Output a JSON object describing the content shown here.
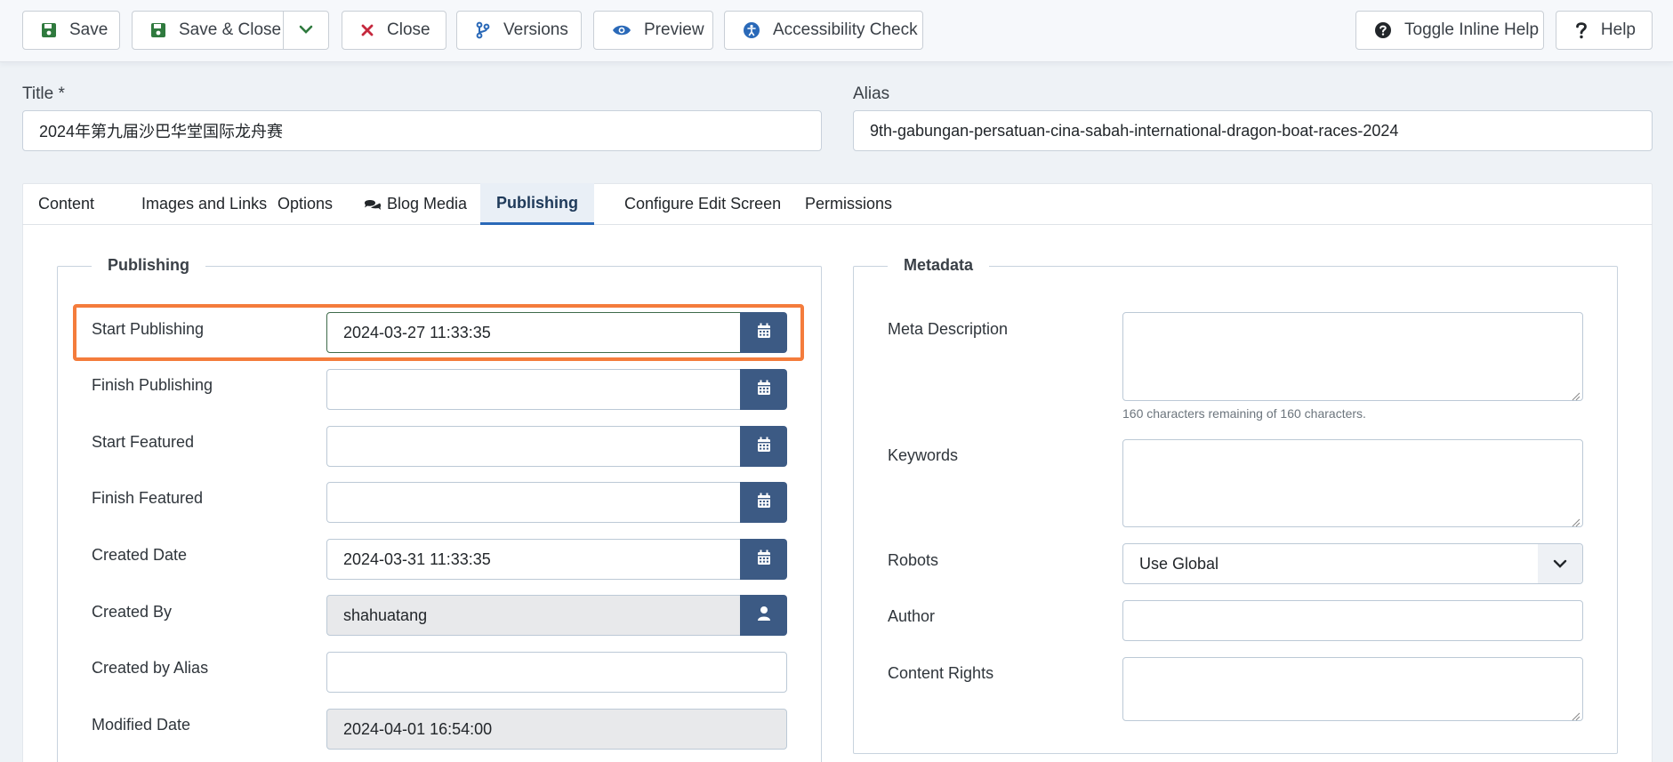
{
  "toolbar": {
    "save": "Save",
    "save_close": "Save & Close",
    "close": "Close",
    "versions": "Versions",
    "preview": "Preview",
    "accessibility": "Accessibility Check",
    "toggle_help": "Toggle Inline Help",
    "help": "Help"
  },
  "title_field": {
    "label": "Title *",
    "value": "2024年第九届沙巴华堂国际龙舟赛"
  },
  "alias_field": {
    "label": "Alias",
    "value": "9th-gabungan-persatuan-cina-sabah-international-dragon-boat-races-2024"
  },
  "tabs": [
    {
      "label": "Content"
    },
    {
      "label": "Images and Links"
    },
    {
      "label": "Options"
    },
    {
      "label": "Blog Media"
    },
    {
      "label": "Publishing"
    },
    {
      "label": "Configure Edit Screen"
    },
    {
      "label": "Permissions"
    }
  ],
  "active_tab": "Publishing",
  "publishing": {
    "legend": "Publishing",
    "start_publishing": {
      "label": "Start Publishing",
      "value": "2024-03-27 11:33:35"
    },
    "finish_publishing": {
      "label": "Finish Publishing",
      "value": ""
    },
    "start_featured": {
      "label": "Start Featured",
      "value": ""
    },
    "finish_featured": {
      "label": "Finish Featured",
      "value": ""
    },
    "created_date": {
      "label": "Created Date",
      "value": "2024-03-31 11:33:35"
    },
    "created_by": {
      "label": "Created By",
      "value": "shahuatang"
    },
    "created_by_alias": {
      "label": "Created by Alias",
      "value": ""
    },
    "modified_date": {
      "label": "Modified Date",
      "value": "2024-04-01 16:54:00"
    }
  },
  "metadata": {
    "legend": "Metadata",
    "meta_description": {
      "label": "Meta Description",
      "hint": "160 characters remaining of 160 characters."
    },
    "keywords": {
      "label": "Keywords"
    },
    "robots": {
      "label": "Robots",
      "value": "Use Global"
    },
    "author": {
      "label": "Author",
      "value": ""
    },
    "content_rights": {
      "label": "Content Rights"
    }
  },
  "colors": {
    "accent": "#3c5a84",
    "highlight": "#f47c3c",
    "save_icon": "#2f7a3e",
    "close_icon": "#c5283d",
    "info_icon": "#2a69b8"
  }
}
